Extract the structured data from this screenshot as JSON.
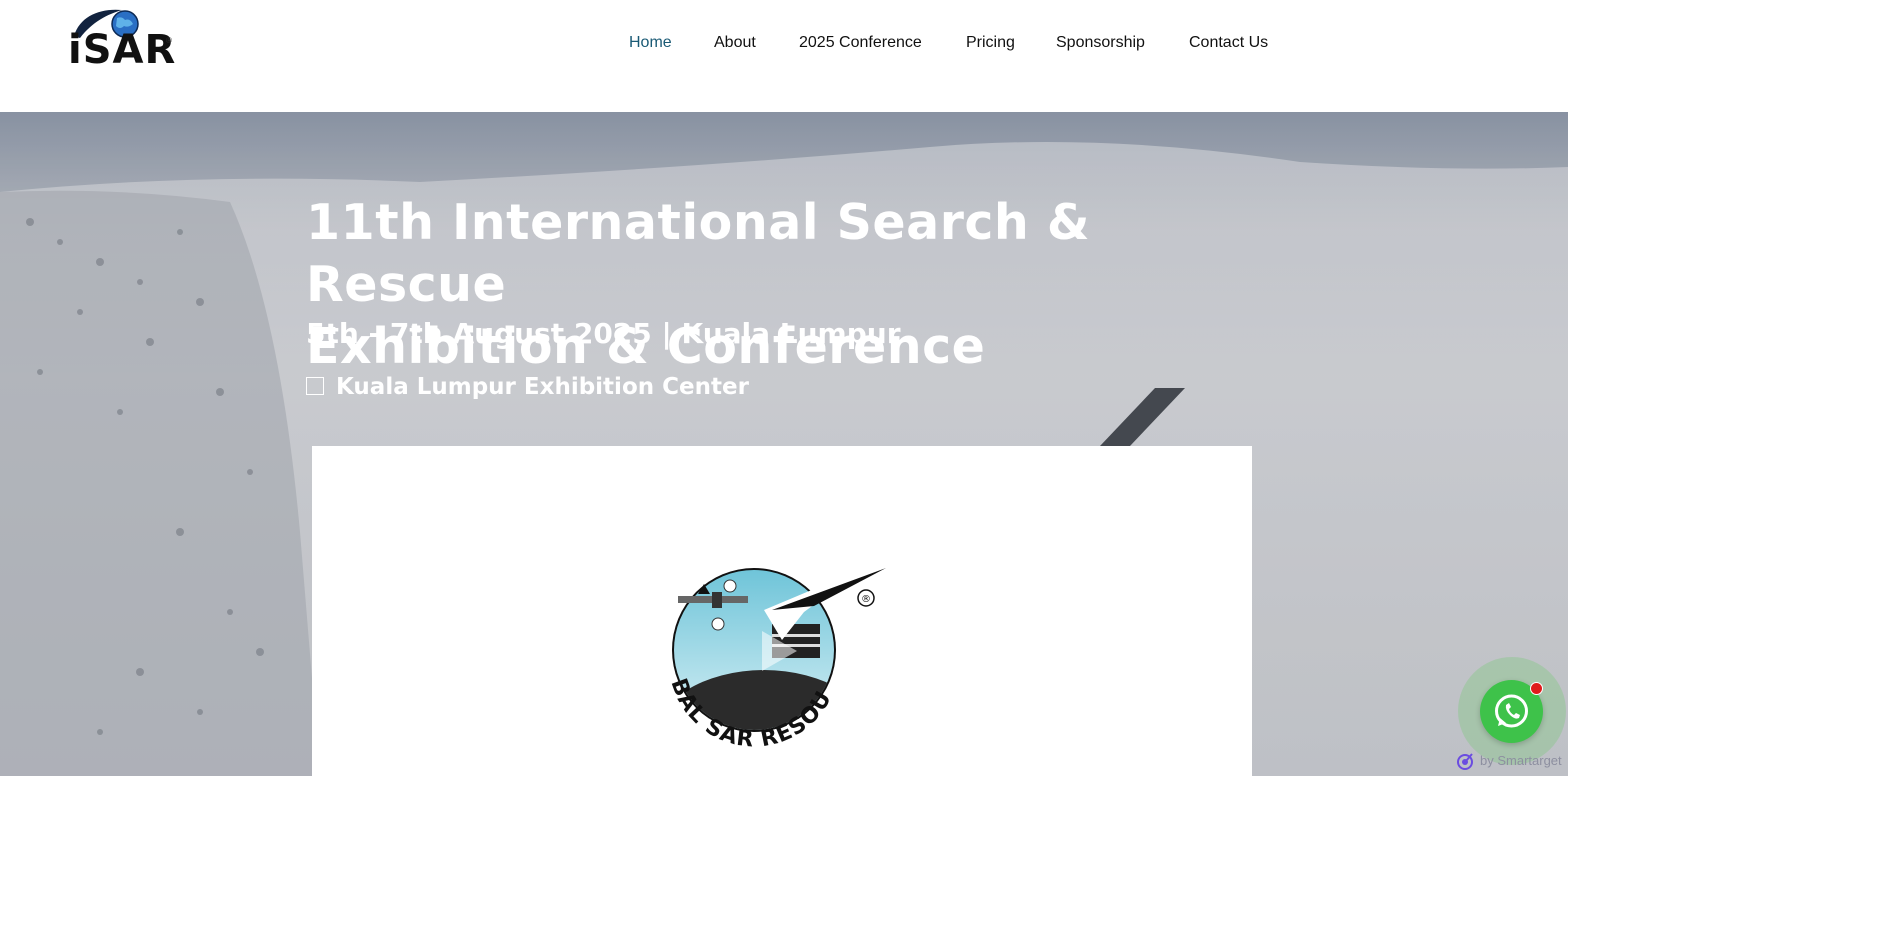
{
  "brand": {
    "logo_text": "iSAR",
    "registered_mark": "®"
  },
  "nav": {
    "items": [
      {
        "label": "Home",
        "active": true
      },
      {
        "label": "About",
        "active": false
      },
      {
        "label": "2025 Conference",
        "active": false
      },
      {
        "label": "Pricing",
        "active": false
      },
      {
        "label": "Sponsorship",
        "active": false
      },
      {
        "label": "Contact Us",
        "active": false
      }
    ],
    "active_color": "#1a5a75"
  },
  "hero": {
    "title_line1": "11th International Search & Rescue",
    "title_line2": "Exhibition & Conference",
    "subtitle": "5th - 7th August 2025 | Kuala Lumpur",
    "venue": "Kuala Lumpur Exhibition Center"
  },
  "video": {
    "logo_text": "GLOBAL SAR RESOURCES",
    "logo_registered": "®",
    "play_icon": "play-icon"
  },
  "widget": {
    "icon": "whatsapp-icon",
    "badge_color": "#e01b1b",
    "button_color": "#3ec24a",
    "credit": "by Smartarget"
  }
}
